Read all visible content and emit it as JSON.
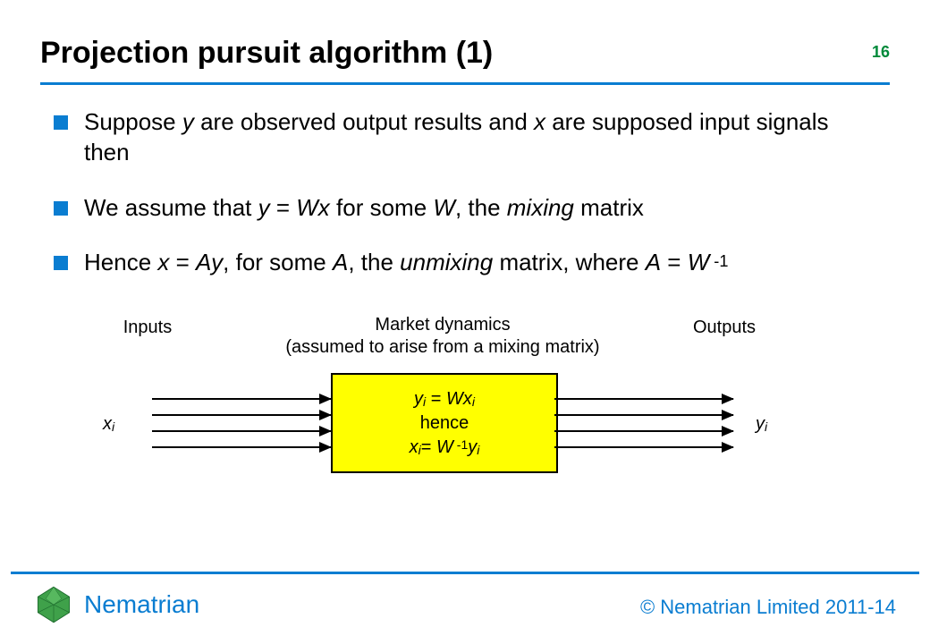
{
  "page_number": "16",
  "title": "Projection pursuit algorithm (1)",
  "bullets": [
    {
      "prefix": "Suppose ",
      "var1": "y",
      "mid1": " are observed output results and ",
      "var2": "x",
      "suffix": " are supposed input signals then"
    },
    {
      "prefix": "We assume that ",
      "eq1a": "y",
      "eq1op": " = ",
      "eq1b": "Wx",
      "mid": " for some ",
      "eq1c": "W",
      "comma": ", the ",
      "mixing": "mixing",
      "suffix": " matrix"
    },
    {
      "prefix": "Hence ",
      "eq2a": "x",
      "eq2op": " = ",
      "eq2b": "Ay",
      "mid": ", for some ",
      "eq2c": "A",
      "comma": ", the ",
      "unmixing": "unmixing",
      "mid2": " matrix, where ",
      "eq2d": "A",
      "eq2op2": " = ",
      "eq2e": "W",
      "exp": " -1"
    }
  ],
  "diagram": {
    "inputs_label": "Inputs",
    "center_label_line1": "Market dynamics",
    "center_label_line2": "(assumed to arise from a mixing matrix)",
    "outputs_label": "Outputs",
    "input_var": "x",
    "input_sub": "i",
    "output_var": "y",
    "output_sub": "i",
    "box_line1_y": "y",
    "box_line1_eq": " = ",
    "box_line1_Wx": "Wx",
    "box_line2": "hence",
    "box_line3_x": "x",
    "box_line3_eq": "= ",
    "box_line3_W": "W",
    "box_line3_exp": " -1",
    "box_line3_y": "y",
    "sub_i": "i"
  },
  "footer": {
    "brand": "Nematrian",
    "copyright": "© Nematrian Limited 2011-14"
  }
}
